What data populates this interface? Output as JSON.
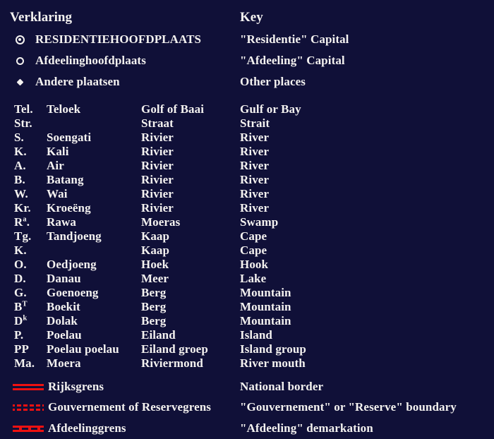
{
  "colors": {
    "background": "#101038",
    "text": "#f4f2f0",
    "border_red": "#ee1111"
  },
  "headings": {
    "dutch": "Verklaring",
    "english": "Key"
  },
  "symbols": [
    {
      "icon": "circle-with-center-dot-icon",
      "dutch": "RESIDENTIEHOOFDPLAATS",
      "english": "\"Residentie\" Capital"
    },
    {
      "icon": "open-circle-icon",
      "dutch": "Afdeelinghoofdplaats",
      "english": "\"Afdeeling\" Capital"
    },
    {
      "icon": "filled-diamond-icon",
      "dutch": "Andere plaatsen",
      "english": "Other places"
    }
  ],
  "abbreviations": [
    {
      "abbr": "Tel.",
      "abbr_sup": "",
      "term": "Teloek",
      "dutch": "Golf of Baai",
      "english": "Gulf or Bay"
    },
    {
      "abbr": "Str.",
      "abbr_sup": "",
      "term": "",
      "dutch": "Straat",
      "english": "Strait"
    },
    {
      "abbr": "S.",
      "abbr_sup": "",
      "term": "Soengati",
      "dutch": "Rivier",
      "english": "River"
    },
    {
      "abbr": "K.",
      "abbr_sup": "",
      "term": "Kali",
      "dutch": "Rivier",
      "english": "River"
    },
    {
      "abbr": "A.",
      "abbr_sup": "",
      "term": "Air",
      "dutch": "Rivier",
      "english": "River"
    },
    {
      "abbr": "B.",
      "abbr_sup": "",
      "term": "Batang",
      "dutch": "Rivier",
      "english": "River"
    },
    {
      "abbr": "W.",
      "abbr_sup": "",
      "term": "Wai",
      "dutch": "Rivier",
      "english": "River"
    },
    {
      "abbr": "Kr.",
      "abbr_sup": "",
      "term": "Kroeëng",
      "dutch": "Rivier",
      "english": "River"
    },
    {
      "abbr": "R",
      "abbr_sup": "a",
      "term": "Rawa",
      "dutch": "Moeras",
      "english": "Swamp"
    },
    {
      "abbr": "Tg.",
      "abbr_sup": "",
      "term": "Tandjoeng",
      "dutch": "Kaap",
      "english": "Cape"
    },
    {
      "abbr": "K.",
      "abbr_sup": "",
      "term": "",
      "dutch": "Kaap",
      "english": "Cape"
    },
    {
      "abbr": "O.",
      "abbr_sup": "",
      "term": "Oedjoeng",
      "dutch": "Hoek",
      "english": "Hook"
    },
    {
      "abbr": "D.",
      "abbr_sup": "",
      "term": "Danau",
      "dutch": "Meer",
      "english": "Lake"
    },
    {
      "abbr": "G.",
      "abbr_sup": "",
      "term": "Goenoeng",
      "dutch": "Berg",
      "english": "Mountain"
    },
    {
      "abbr": "B",
      "abbr_sup": "T",
      "term": "Boekit",
      "dutch": "Berg",
      "english": "Mountain"
    },
    {
      "abbr": "D",
      "abbr_sup": "k",
      "term": "Dolak",
      "dutch": "Berg",
      "english": "Mountain"
    },
    {
      "abbr": "P.",
      "abbr_sup": "",
      "term": "Poelau",
      "dutch": "Eiland",
      "english": "Island"
    },
    {
      "abbr": "PP",
      "abbr_sup": "",
      "term": "Poelau poelau",
      "dutch": "Eiland groep",
      "english": "Island group"
    },
    {
      "abbr": "Ma.",
      "abbr_sup": "",
      "term": "Moera",
      "dutch": "Riviermond",
      "english": "River mouth"
    }
  ],
  "borders": [
    {
      "icon": "solid-border-line-icon",
      "dutch": "Rijksgrens",
      "english": "National border"
    },
    {
      "icon": "cross-hatched-border-line-icon",
      "dutch": "Gouvernement of Reservegrens",
      "english": "\"Gouvernement\" or \"Reserve\" boundary"
    },
    {
      "icon": "dashed-border-line-icon",
      "dutch": "Afdeelinggrens",
      "english": "\"Afdeeling\" demarkation"
    }
  ]
}
